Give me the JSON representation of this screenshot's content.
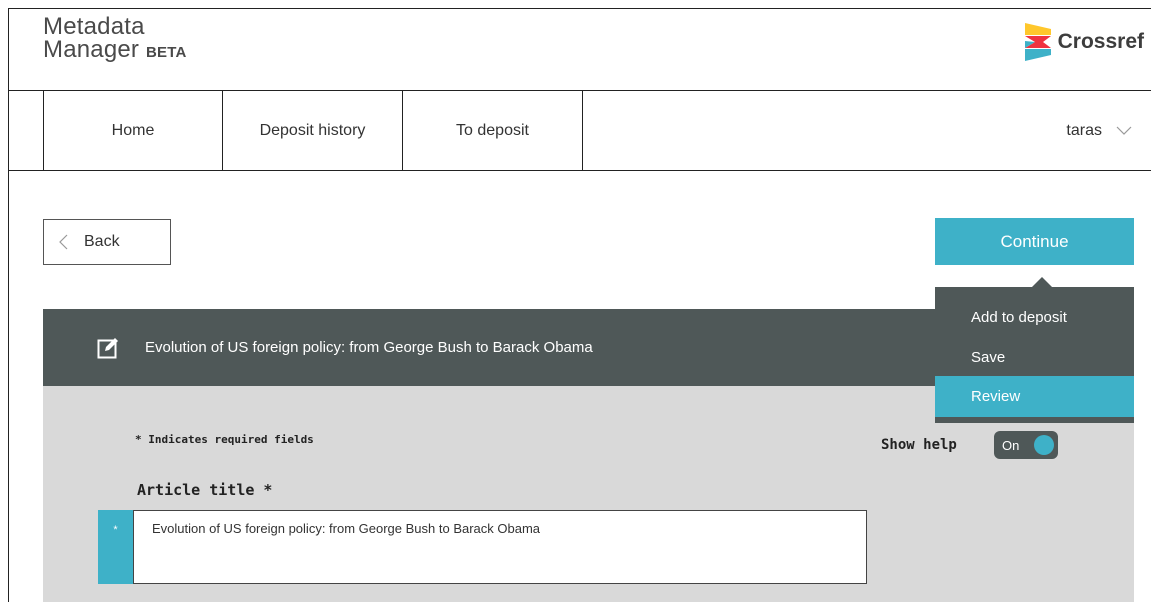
{
  "app": {
    "name_line1": "Metadata",
    "name_line2": "Manager",
    "badge": "BETA",
    "brand": "Crossref"
  },
  "nav": {
    "home": "Home",
    "deposit_history": "Deposit history",
    "to_deposit": "To deposit",
    "user": "taras"
  },
  "actions": {
    "back": "Back",
    "continue": "Continue",
    "menu": [
      "Add to deposit",
      "Save",
      "Review"
    ],
    "menu_highlighted": "Review"
  },
  "record": {
    "title": "Evolution of US foreign policy: from George Bush to Barack Obama"
  },
  "form": {
    "required_note": "* Indicates required fields",
    "show_help_label": "Show help",
    "show_help_state": "On",
    "article_title_label": "Article title *",
    "required_marker": "*",
    "article_title_value": "Evolution of US foreign policy: from George Bush to Barack Obama"
  },
  "colors": {
    "accent": "#3eb1c8",
    "dark": "#4f5858",
    "panel": "#d9d9d9"
  }
}
